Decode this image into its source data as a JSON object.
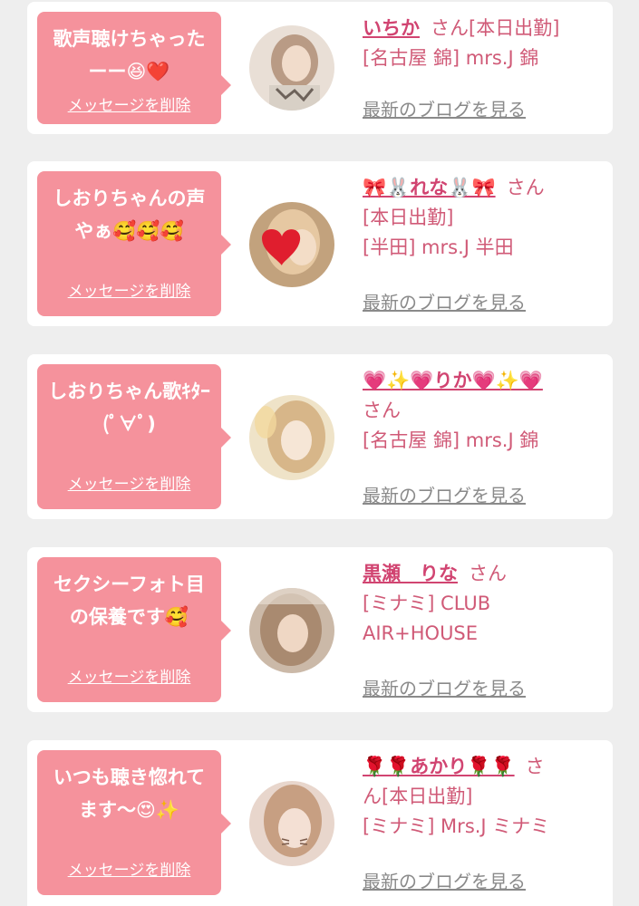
{
  "cards": [
    {
      "message": "歌声聴けちゃったーー😆❤️",
      "delete_label": "メッセージを削除",
      "name": "いちか",
      "san": "さん",
      "status": "[本日出勤]",
      "shop_lines": [
        "[名古屋 錦] mrs.J 錦"
      ],
      "blog_label": "最新のブログを見る"
    },
    {
      "message": "しおりちゃんの声やぁ🥰🥰🥰",
      "delete_label": "メッセージを削除",
      "name": "🎀🐰れな🐰🎀",
      "san": "さん",
      "status": "[本日出勤]",
      "shop_lines": [
        "[半田] mrs.J 半田"
      ],
      "blog_label": "最新のブログを見る"
    },
    {
      "message": "しおりちゃん歌ｷﾀｰ(ﾟ∀ﾟ)",
      "delete_label": "メッセージを削除",
      "name": "💗✨💗りか💗✨💗",
      "san": "さん",
      "status": "",
      "shop_lines": [
        "[名古屋 錦] mrs.J 錦"
      ],
      "blog_label": "最新のブログを見る"
    },
    {
      "message": "セクシーフォト目の保養です🥰",
      "delete_label": "メッセージを削除",
      "name": "黒瀬　りな",
      "san": "さん",
      "status": "",
      "shop_lines": [
        "[ミナミ] CLUB",
        "AIR+HOUSE"
      ],
      "blog_label": "最新のブログを見る"
    },
    {
      "message": "いつも聴き惚れてます〜😍✨",
      "delete_label": "メッセージを削除",
      "name": "🌹🌹あかり🌹🌹",
      "san": "さ",
      "san_cont": "ん",
      "status": "[本日出勤]",
      "shop_lines": [
        "[ミナミ] Mrs.J ミナミ"
      ],
      "blog_label": "最新のブログを見る"
    }
  ],
  "colors": {
    "bubble": "#f5929c",
    "name": "#d14471",
    "text": "#d05a77",
    "link_gray": "#8a8a8a",
    "background": "#eeeeee"
  }
}
